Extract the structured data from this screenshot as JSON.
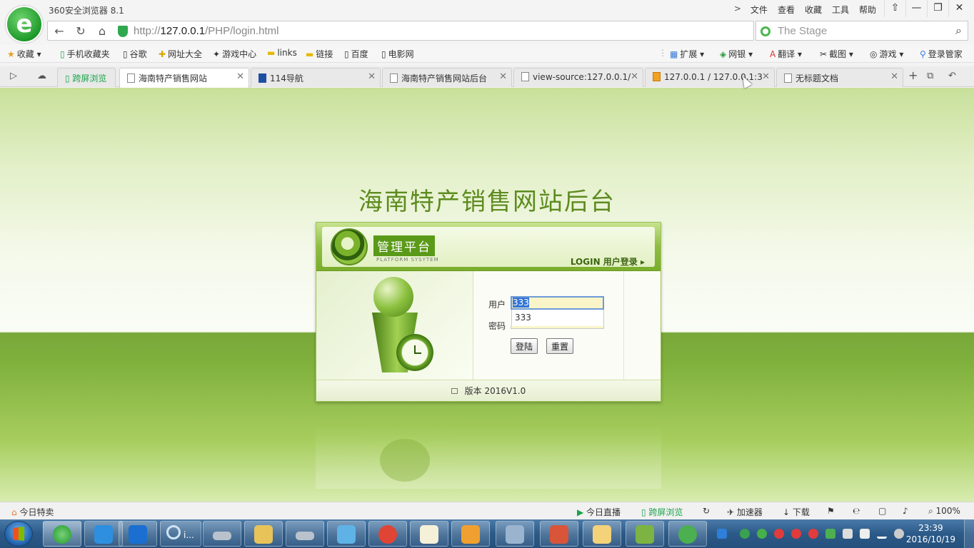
{
  "window": {
    "app_title": "360安全浏览器 8.1",
    "menu": [
      "文件",
      "查看",
      "收藏",
      "工具",
      "帮助"
    ],
    "menu_chevron": ">",
    "controls": {
      "pin": "⇧",
      "minimize": "—",
      "maximize": "❐",
      "close": "✕"
    }
  },
  "navbar": {
    "back": "←",
    "refresh": "↻",
    "home": "⌂",
    "url_prefix": "http://",
    "url_host": "127.0.0.1",
    "url_path": "/PHP/login.html",
    "search_placeholder": "The Stage",
    "search_icon": "⌕"
  },
  "bookmarks": {
    "left": [
      {
        "label": "收藏",
        "icon": "★"
      },
      {
        "label": "手机收藏夹",
        "icon": "▯"
      },
      {
        "label": "谷歌",
        "icon": "▯"
      },
      {
        "label": "网址大全",
        "icon": "✚"
      },
      {
        "label": "游戏中心",
        "icon": "✦"
      },
      {
        "label": "links",
        "icon": "▬"
      },
      {
        "label": "链接",
        "icon": "▬"
      },
      {
        "label": "百度",
        "icon": "▯"
      },
      {
        "label": "电影网",
        "icon": "▯"
      }
    ],
    "right": [
      {
        "label": "扩展",
        "icon": "▦"
      },
      {
        "label": "网银",
        "icon": "◈"
      },
      {
        "label": "翻译",
        "icon": "A"
      },
      {
        "label": "截图",
        "icon": "✂"
      },
      {
        "label": "游戏",
        "icon": "◎"
      },
      {
        "label": "登录管家",
        "icon": "⚲"
      }
    ]
  },
  "tabs": {
    "cross_screen": "跨屏浏览",
    "items": [
      {
        "label": "海南特产销售网站",
        "active": true
      },
      {
        "label": "114导航",
        "active": false
      },
      {
        "label": "海南特产销售网站后台",
        "active": false
      },
      {
        "label": "view-source:127.0.0.1/",
        "active": false
      },
      {
        "label": "127.0.0.1 / 127.0.0.1:3",
        "active": false
      },
      {
        "label": "无标题文档",
        "active": false
      }
    ],
    "new_tab": "+",
    "close": "✕"
  },
  "page": {
    "title": "海南特产销售网站后台",
    "platform_label": "管理平台",
    "platform_sub": "PLATFORM SYSYTEM",
    "login_tag": "LOGIN 用户登录 ▸",
    "user_label": "用户",
    "user_value": "333",
    "autocomplete_option": "333",
    "pass_label": "密码",
    "login_button": "登陆",
    "reset_button": "重置",
    "version": "版本 2016V1.0"
  },
  "statusbar": {
    "today_deals": "今日特卖",
    "today_live": "今日直播",
    "cross_screen": "跨屏浏览",
    "accelerator": "加速器",
    "download": "下载",
    "zoom": "100%"
  },
  "taskbar": {
    "search_label": "i...",
    "clock_time": "23:39",
    "clock_date": "2016/10/19"
  },
  "colors": {
    "brand_green": "#5d8b1f",
    "tab_active": "#ffffff",
    "taskbar": "#2c5a88"
  }
}
